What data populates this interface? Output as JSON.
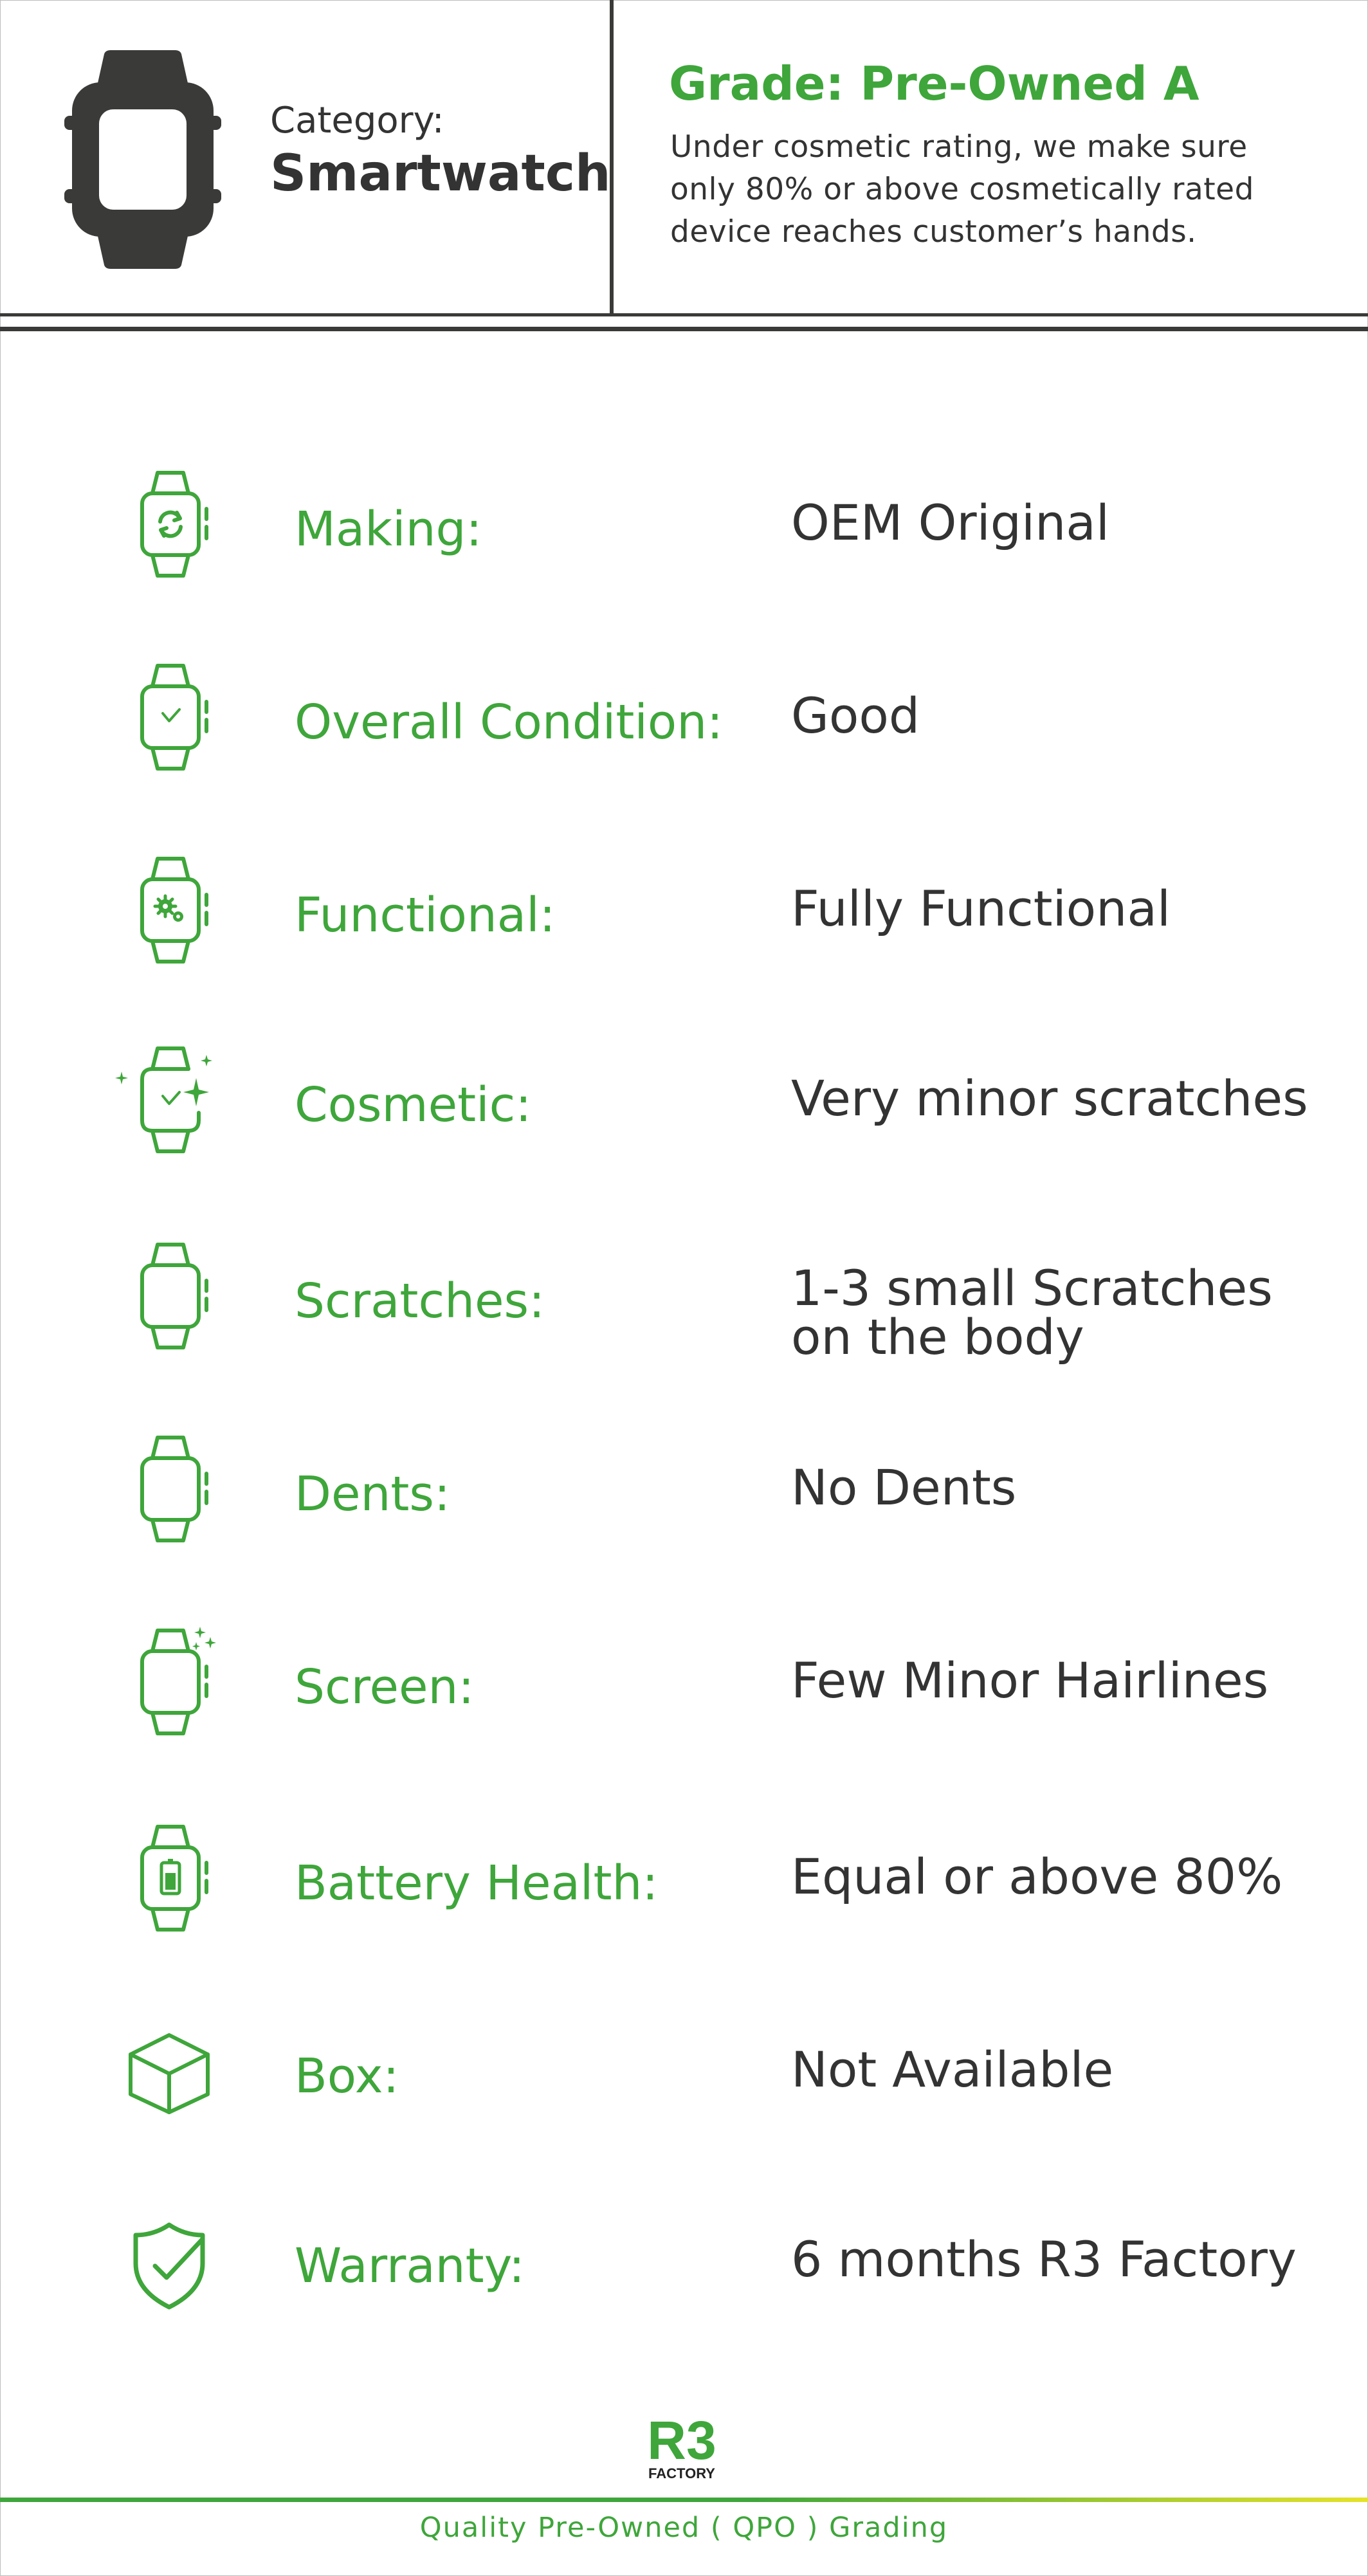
{
  "header": {
    "category_label": "Category:",
    "category_value": "Smartwatch",
    "category_icon": "smartwatch-icon",
    "grade_title": "Grade: Pre-Owned A",
    "grade_description": "Under cosmetic rating, we make sure only 80% or above cosmetically rated device reaches customer’s hands."
  },
  "rows": [
    {
      "icon": "watch-refresh-icon",
      "label": "Making:",
      "value": "OEM Original"
    },
    {
      "icon": "watch-check-icon",
      "label": "Overall Condition:",
      "value": "Good"
    },
    {
      "icon": "watch-gears-icon",
      "label": "Functional:",
      "value": "Fully Functional"
    },
    {
      "icon": "watch-sparkle-icon",
      "label": "Cosmetic:",
      "value": "Very minor scratches"
    },
    {
      "icon": "watch-icon",
      "label": "Scratches:",
      "value": "1-3 small Scratches\non the body"
    },
    {
      "icon": "watch-icon",
      "label": "Dents:",
      "value": "No Dents"
    },
    {
      "icon": "watch-stars-icon",
      "label": "Screen:",
      "value": "Few Minor Hairlines"
    },
    {
      "icon": "watch-battery-icon",
      "label": "Battery Health:",
      "value": "Equal or above 80%"
    },
    {
      "icon": "box-icon",
      "label": "Box:",
      "value": "Not Available"
    },
    {
      "icon": "shield-check-icon",
      "label": "Warranty:",
      "value": "6 months R3 Factory"
    }
  ],
  "footer": {
    "logo_text": "R3",
    "logo_subtext": "FACTORY",
    "tagline": "Quality Pre-Owned ( QPO ) Grading"
  },
  "colors": {
    "accent_green": "#3ea63a",
    "text_dark": "#333333",
    "footer_gradient_end": "#e6e22a"
  }
}
